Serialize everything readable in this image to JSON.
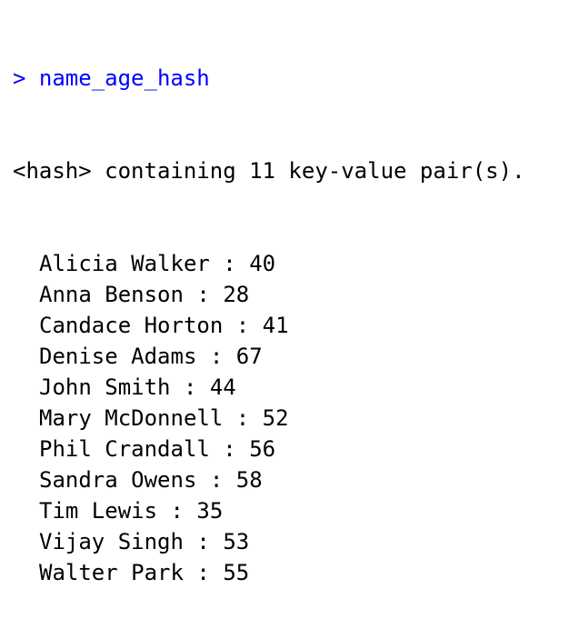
{
  "console": {
    "prompt_symbol": ">",
    "command": "name_age_hash",
    "header": "<hash> containing 11 key-value pair(s).",
    "separator": " : ",
    "entries": [
      {
        "name": "Alicia Walker",
        "age": "40"
      },
      {
        "name": "Anna Benson",
        "age": "28"
      },
      {
        "name": "Candace Horton",
        "age": "41"
      },
      {
        "name": "Denise Adams",
        "age": "67"
      },
      {
        "name": "John Smith",
        "age": "44"
      },
      {
        "name": "Mary McDonnell",
        "age": "52"
      },
      {
        "name": "Phil Crandall",
        "age": "56"
      },
      {
        "name": "Sandra Owens",
        "age": "58"
      },
      {
        "name": "Tim Lewis",
        "age": "35"
      },
      {
        "name": "Vijay Singh",
        "age": "53"
      },
      {
        "name": "Walter Park",
        "age": "55"
      }
    ]
  },
  "colors": {
    "prompt": "#0000ff",
    "output": "#000000",
    "background": "#ffffff"
  }
}
